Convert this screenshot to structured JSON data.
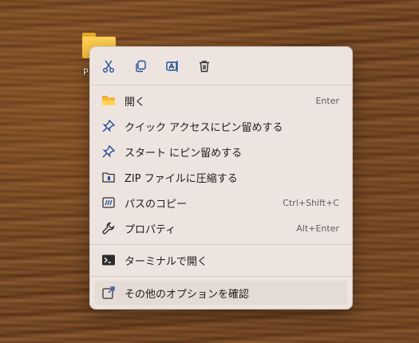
{
  "desktop": {
    "icon_label": "P"
  },
  "menu": {
    "toolbar": [
      {
        "icon": "cut-icon"
      },
      {
        "icon": "copy-icon"
      },
      {
        "icon": "rename-icon"
      },
      {
        "icon": "delete-icon"
      }
    ],
    "items": [
      {
        "label": "開く",
        "shortcut": "Enter",
        "icon": "folder-icon"
      },
      {
        "label": "クイック アクセスにピン留めする",
        "shortcut": "",
        "icon": "pin-icon"
      },
      {
        "label": "スタート にピン留めする",
        "shortcut": "",
        "icon": "pin-icon"
      },
      {
        "label": "ZIP ファイルに圧縮する",
        "shortcut": "",
        "icon": "zip-icon"
      },
      {
        "label": "パスのコピー",
        "shortcut": "Ctrl+Shift+C",
        "icon": "copy-path-icon"
      },
      {
        "label": "プロパティ",
        "shortcut": "Alt+Enter",
        "icon": "wrench-icon"
      },
      {
        "label": "ターミナルで開く",
        "shortcut": "",
        "icon": "terminal-icon"
      },
      {
        "label": "その他のオプションを確認",
        "shortcut": "",
        "icon": "external-link-icon"
      }
    ]
  },
  "colors": {
    "accent": "#1f4f9a",
    "menu_background": "#eee4df",
    "folder_yellow": "#f5b93a"
  }
}
